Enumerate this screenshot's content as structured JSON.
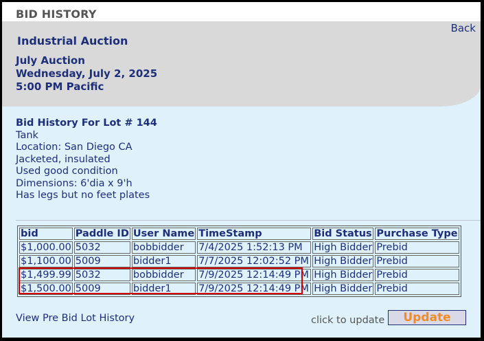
{
  "page": {
    "title": "BID HISTORY",
    "back_label": "Back"
  },
  "event": {
    "name": "Industrial Auction",
    "auction_name": "July Auction",
    "date": "Wednesday, July 2, 2025",
    "time": "5:00 PM Pacific"
  },
  "lot": {
    "heading": "Bid History For Lot # 144",
    "lines": [
      "Tank",
      "Location:  San Diego CA",
      "Jacketed, insulated",
      "Used good condition",
      "Dimensions:  6'dia x 9'h",
      "Has legs but no feet plates"
    ]
  },
  "bids_table": {
    "columns": [
      "bid",
      "Paddle ID",
      "User Name",
      "TimeStamp",
      "Bid Status",
      "Purchase Type"
    ],
    "rows": [
      [
        "$1,000.00",
        "5032",
        "bobbidder",
        "7/4/2025 1:52:13 PM",
        "High Bidder",
        "Prebid"
      ],
      [
        "$1,100.00",
        "5009",
        "bidder1",
        "7/7/2025 12:02:52 PM",
        "High Bidder",
        "Prebid"
      ],
      [
        "$1,499.99",
        "5032",
        "bobbidder",
        "7/9/2025 12:14:49 PM",
        "High Bidder",
        "Prebid"
      ],
      [
        "$1,500.00",
        "5009",
        "bidder1",
        "7/9/2025 12:14:49 PM",
        "High Bidder",
        "Prebid"
      ]
    ]
  },
  "footer": {
    "pre_bid_link": "View Pre Bid Lot History",
    "update_hint": "click to update",
    "update_button": "Update"
  },
  "colors": {
    "text_primary": "#1e2f7a",
    "header_band": "#d9d9d9",
    "content_bg": "#dff1fb",
    "highlight_outline": "#d40000",
    "update_text": "#f08c28"
  }
}
